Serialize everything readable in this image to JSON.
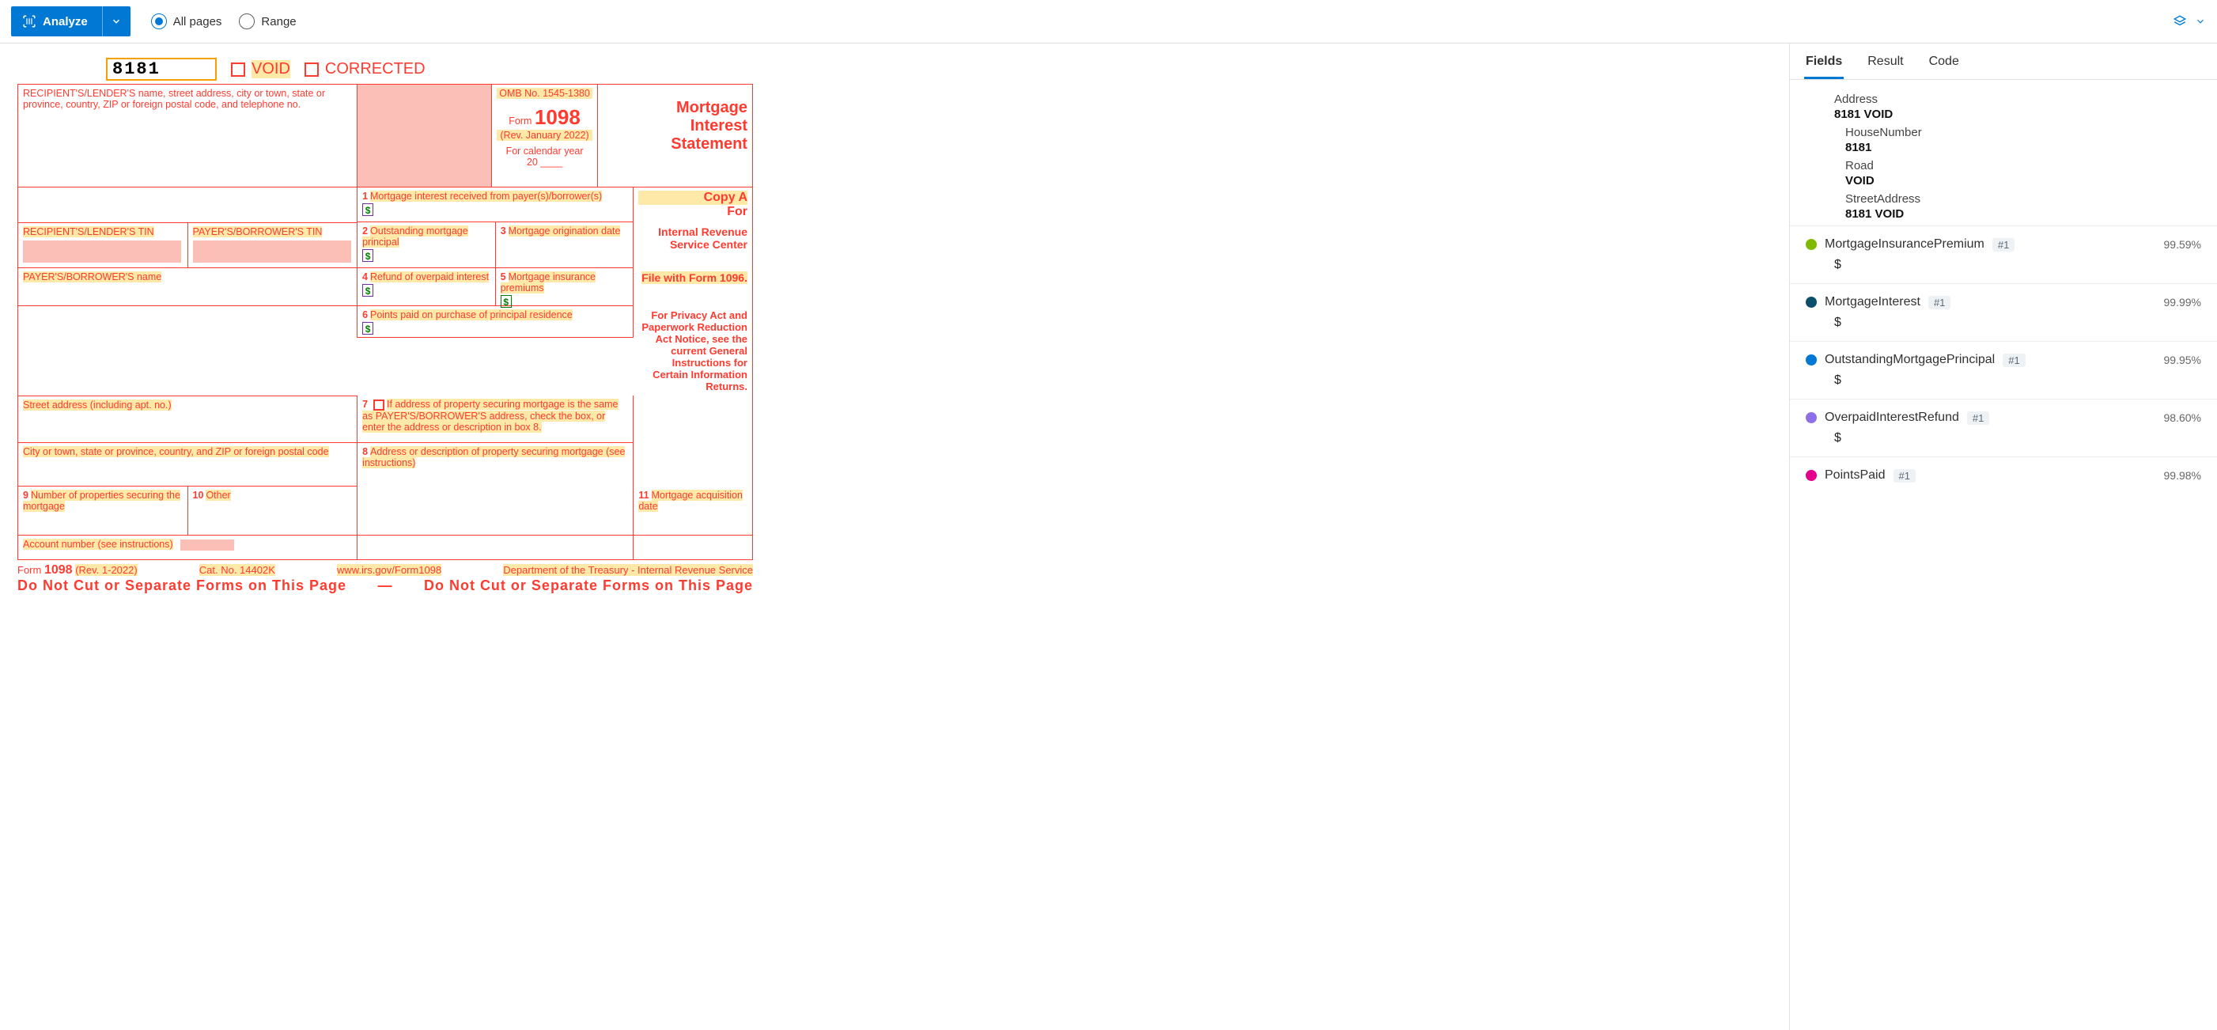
{
  "toolbar": {
    "analyze_label": "Analyze",
    "all_pages_label": "All pages",
    "range_label": "Range",
    "selected": "all"
  },
  "tabs": {
    "fields": "Fields",
    "result": "Result",
    "code": "Code",
    "active": "fields"
  },
  "doc": {
    "code": "8181",
    "void": "VOID",
    "corrected": "CORRECTED",
    "recipient_header": "RECIPIENT'S/LENDER'S name, street address, city or town, state or province, country, ZIP or foreign postal code, and telephone no.",
    "omb": "OMB No. 1545-1380",
    "form_word": "Form",
    "form_no": "1098",
    "rev": "(Rev. January 2022)",
    "cal": "For calendar year",
    "cal_prefix": "20",
    "title1": "Mortgage",
    "title2": "Interest",
    "title3": "Statement",
    "box1": "Mortgage interest received from payer(s)/borrower(s)",
    "recipient_tin": "RECIPIENT'S/LENDER'S TIN",
    "payer_tin": "PAYER'S/BORROWER'S TIN",
    "box2": "Outstanding mortgage principal",
    "box3": "Mortgage origination date",
    "box4": "Refund of overpaid interest",
    "box5": "Mortgage insurance premiums",
    "payer_name_lbl": "PAYER'S/BORROWER'S name",
    "box6": "Points paid on purchase of principal residence",
    "street_lbl": "Street address (including apt. no.)",
    "box7": "If address of property securing mortgage is the same as PAYER'S/BORROWER'S address, check the box, or enter the address or description in box 8.",
    "city_lbl": "City or town, state or province, country, and ZIP or foreign postal code",
    "box8": "Address or description of property securing mortgage (see instructions)",
    "box9": "Number of properties securing the mortgage",
    "box10": "Other",
    "box11": "Mortgage acquisition date",
    "acct": "Account number (see instructions)",
    "copyA": "Copy A",
    "for": "For",
    "irs1": "Internal Revenue",
    "irs2": "Service Center",
    "file1096": "File with Form 1096.",
    "privacy": "For Privacy Act and Paperwork Reduction Act Notice, see the current General Instructions for Certain Information Returns.",
    "footer_form": "Form",
    "footer_1098": "1098",
    "footer_rev": "(Rev. 1-2022)",
    "cat": "Cat. No. 14402K",
    "url": "www.irs.gov/Form1098",
    "dept": "Department of the Treasury - Internal Revenue Service",
    "nocut_left": "Do  Not  Cut  or  Separate  Forms  on  This  Page",
    "nocut_dash": "—",
    "nocut_right": "Do  Not  Cut  or  Separate  Forms  on  This  Page"
  },
  "address_block": {
    "title": "Address",
    "value": "8181 VOID",
    "house_lbl": "HouseNumber",
    "house_val": "8181",
    "road_lbl": "Road",
    "road_val": "VOID",
    "street_lbl": "StreetAddress",
    "street_val": "8181 VOID"
  },
  "fields": [
    {
      "color": "#7fba00",
      "name": "MortgageInsurancePremium",
      "badge": "#1",
      "conf": "99.59%",
      "value": "$"
    },
    {
      "color": "#0b4f6c",
      "name": "MortgageInterest",
      "badge": "#1",
      "conf": "99.99%",
      "value": "$"
    },
    {
      "color": "#0078d4",
      "name": "OutstandingMortgagePrincipal",
      "badge": "#1",
      "conf": "99.95%",
      "value": "$"
    },
    {
      "color": "#8f6fe8",
      "name": "OverpaidInterestRefund",
      "badge": "#1",
      "conf": "98.60%",
      "value": "$"
    },
    {
      "color": "#e3008c",
      "name": "PointsPaid",
      "badge": "#1",
      "conf": "99.98%",
      "value": ""
    }
  ]
}
